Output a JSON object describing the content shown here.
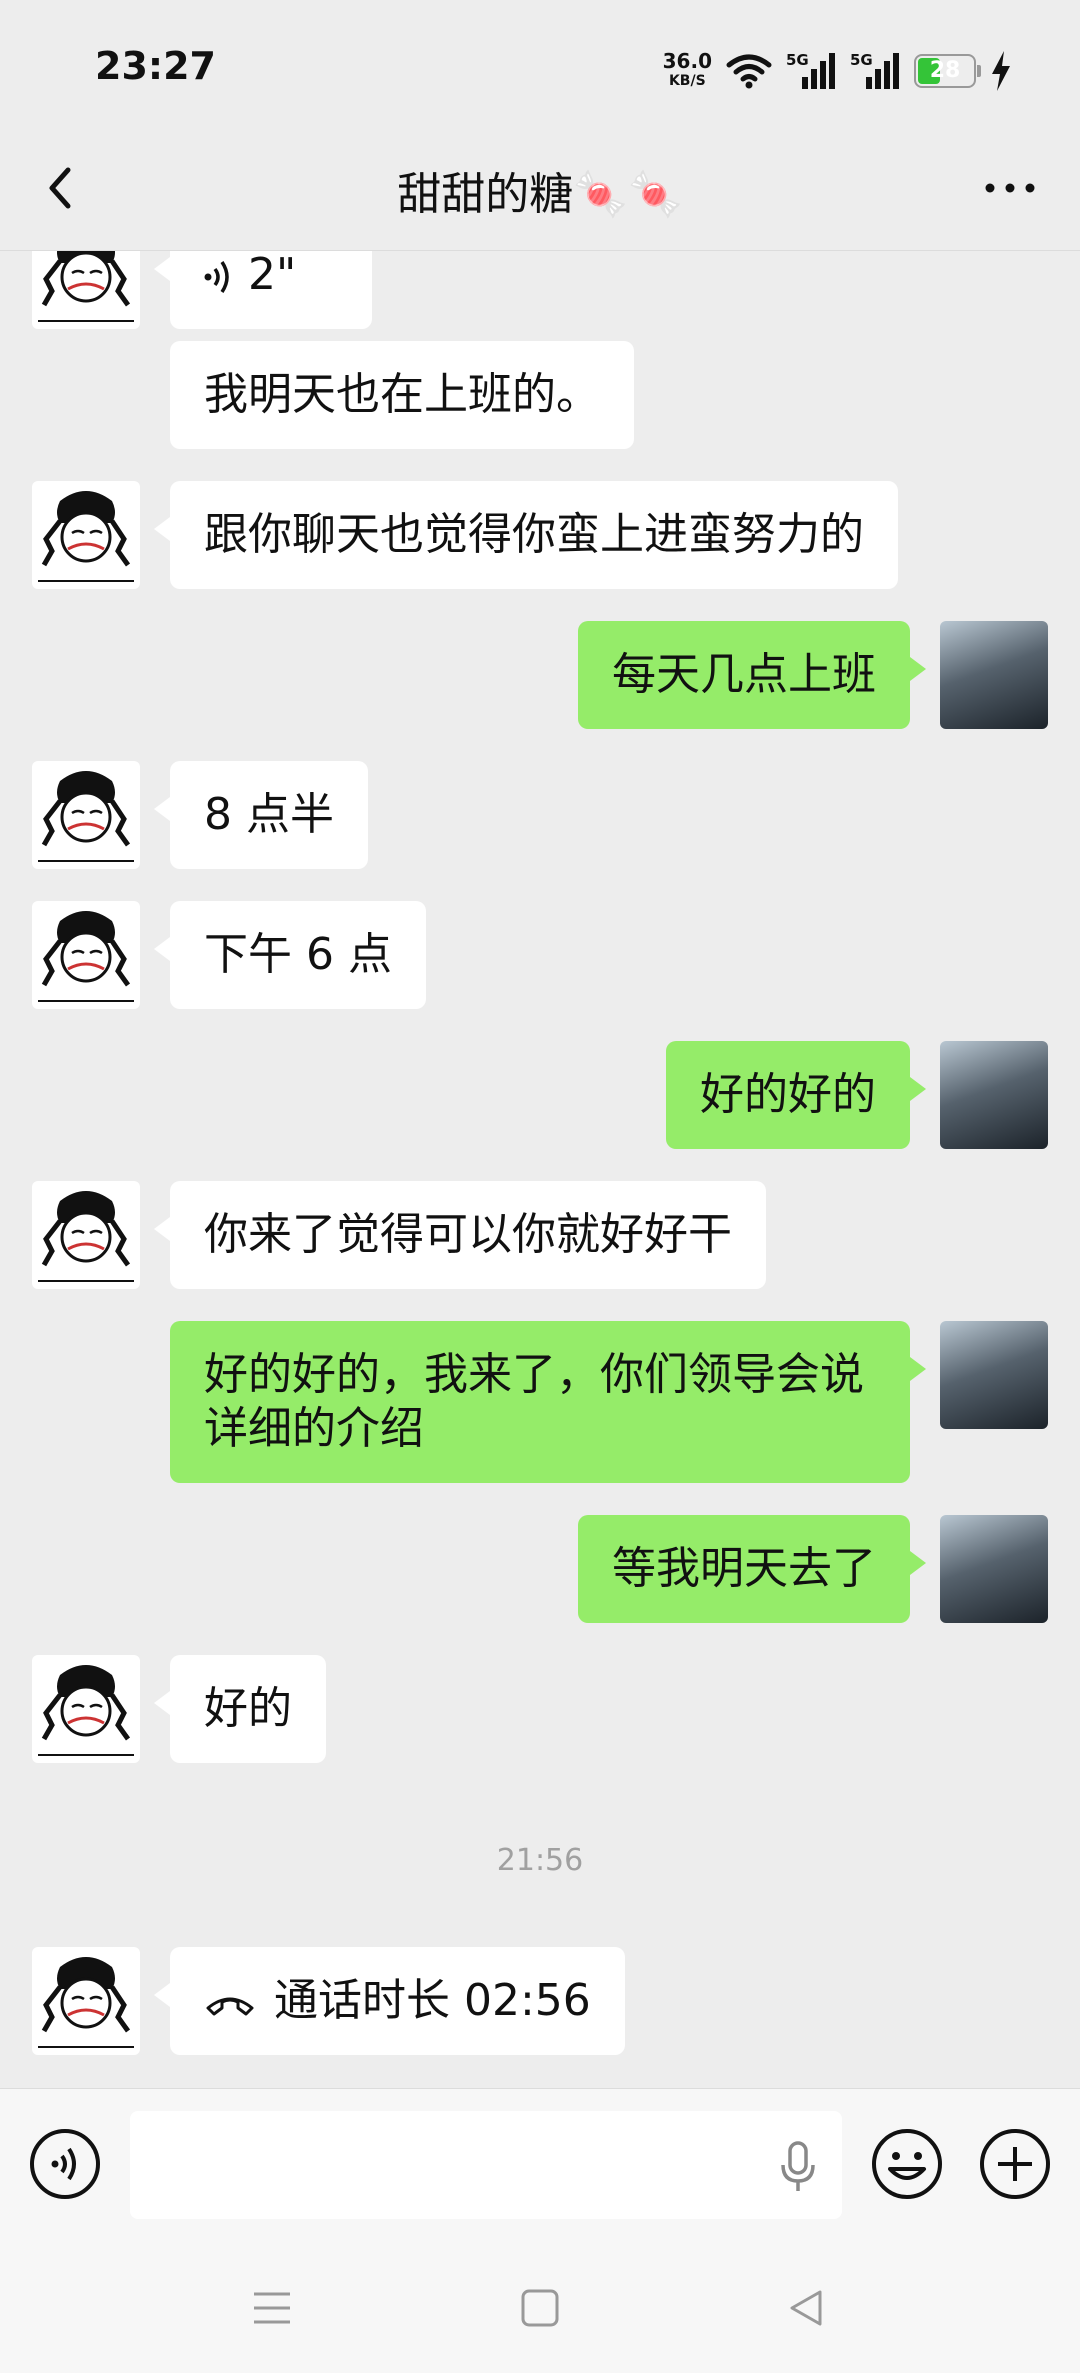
{
  "status_bar": {
    "time": "23:27",
    "net_speed": "36.0",
    "net_unit": "KB/S",
    "signal1": "5G",
    "signal2": "5G",
    "battery": "28"
  },
  "header": {
    "title": "甜甜的糖🍬🍬"
  },
  "messages": [
    {
      "side": "in",
      "type": "voice",
      "text": "2\""
    },
    {
      "side": "in",
      "type": "text",
      "text": "我明天也在上班的。"
    },
    {
      "side": "in",
      "type": "text",
      "text": "跟你聊天也觉得你蛮上进蛮努力的"
    },
    {
      "side": "out",
      "type": "text",
      "text": "每天几点上班"
    },
    {
      "side": "in",
      "type": "text",
      "text": "8 点半"
    },
    {
      "side": "in",
      "type": "text",
      "text": "下午 6 点"
    },
    {
      "side": "out",
      "type": "text",
      "text": "好的好的"
    },
    {
      "side": "in",
      "type": "text",
      "text": "你来了觉得可以你就好好干"
    },
    {
      "side": "out",
      "type": "text",
      "text": "好的好的，我来了，你们领导会说详细的介绍"
    },
    {
      "side": "out",
      "type": "text",
      "text": "等我明天去了"
    },
    {
      "side": "in",
      "type": "text",
      "text": "好的"
    }
  ],
  "timestamp": "21:56",
  "call": {
    "text": "通话时长 02:56",
    "icon": "phone-hangup-icon"
  },
  "input": {
    "placeholder": ""
  },
  "colors": {
    "background": "#ededed",
    "incoming": "#ffffff",
    "outgoing": "#95ec69"
  }
}
